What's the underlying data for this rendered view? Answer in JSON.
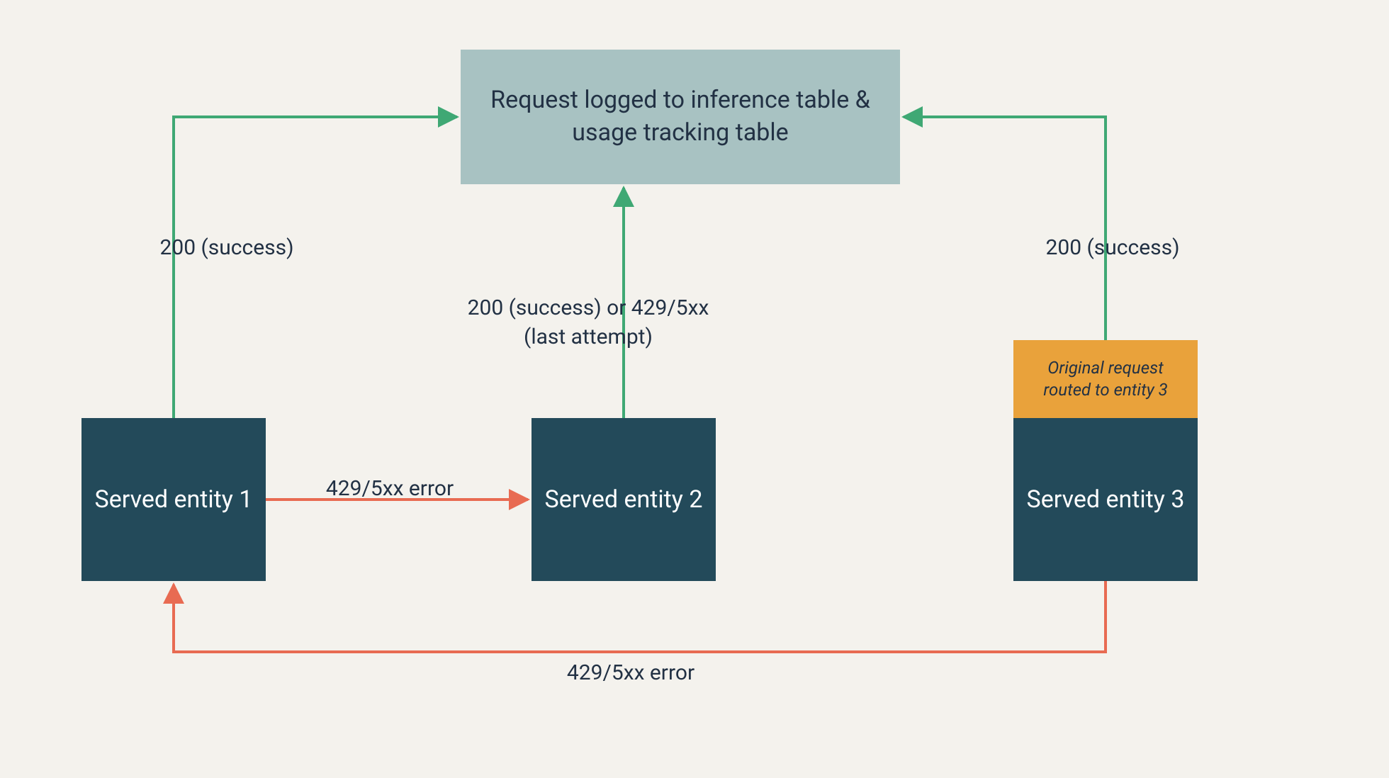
{
  "top_box": {
    "label": "Request logged to inference table & usage tracking table"
  },
  "entities": {
    "e1": {
      "label": "Served entity 1"
    },
    "e2": {
      "label": "Served entity 2"
    },
    "e3": {
      "label": "Served entity 3"
    },
    "e3_hat": {
      "label": "Original request routed to entity 3"
    }
  },
  "edges": {
    "success_left": {
      "label": "200 (success)"
    },
    "success_mid": {
      "label": "200 (success) or 429/5xx (last attempt)"
    },
    "success_right": {
      "label": "200 (success)"
    },
    "error_1_to_2": {
      "label": "429/5xx error"
    },
    "error_3_to_1": {
      "label": "429/5xx error"
    }
  },
  "colors": {
    "bg": "#f4f2ed",
    "top_box": "#a8c2c2",
    "entity": "#234a5a",
    "hat": "#e9a23b",
    "green": "#3fa874",
    "red": "#e86b52",
    "text": "#223144"
  }
}
